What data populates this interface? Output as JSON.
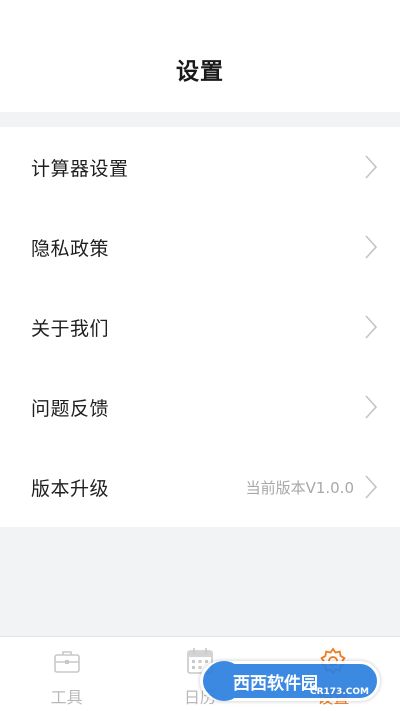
{
  "header": {
    "title": "设置"
  },
  "menu": {
    "items": [
      {
        "label": "计算器设置",
        "value": ""
      },
      {
        "label": "隐私政策",
        "value": ""
      },
      {
        "label": "关于我们",
        "value": ""
      },
      {
        "label": "问题反馈",
        "value": ""
      },
      {
        "label": "版本升级",
        "value": "当前版本V1.0.0"
      }
    ]
  },
  "tabbar": {
    "active_color": "#f07b1f",
    "inactive_color": "#b9b9b9",
    "tabs": [
      {
        "label": "工具",
        "icon": "briefcase-icon",
        "active": false
      },
      {
        "label": "日历",
        "icon": "calendar-icon",
        "active": false
      },
      {
        "label": "设置",
        "icon": "gear-icon",
        "active": true
      }
    ]
  },
  "watermark": {
    "main": "西西软件园",
    "sub": "CR173.COM"
  }
}
